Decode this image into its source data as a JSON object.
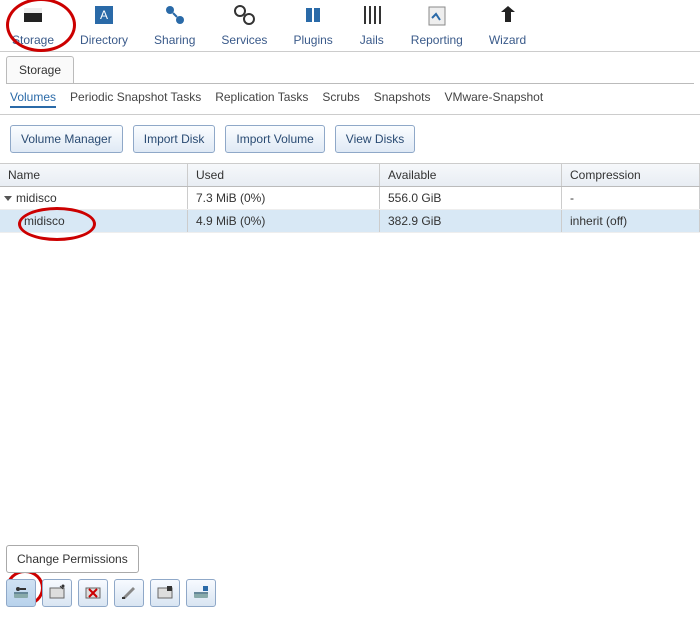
{
  "nav": {
    "items": [
      {
        "label": "Storage",
        "icon": "storage"
      },
      {
        "label": "Directory",
        "icon": "directory"
      },
      {
        "label": "Sharing",
        "icon": "sharing"
      },
      {
        "label": "Services",
        "icon": "services"
      },
      {
        "label": "Plugins",
        "icon": "plugins"
      },
      {
        "label": "Jails",
        "icon": "jails"
      },
      {
        "label": "Reporting",
        "icon": "reporting"
      },
      {
        "label": "Wizard",
        "icon": "wizard"
      }
    ]
  },
  "main_tab": {
    "label": "Storage"
  },
  "sub_tabs": {
    "items": [
      {
        "label": "Volumes",
        "active": true
      },
      {
        "label": "Periodic Snapshot Tasks"
      },
      {
        "label": "Replication Tasks"
      },
      {
        "label": "Scrubs"
      },
      {
        "label": "Snapshots"
      },
      {
        "label": "VMware-Snapshot"
      }
    ]
  },
  "buttons": {
    "volume_manager": "Volume Manager",
    "import_disk": "Import Disk",
    "import_volume": "Import Volume",
    "view_disks": "View Disks"
  },
  "grid": {
    "headers": {
      "name": "Name",
      "used": "Used",
      "available": "Available",
      "compression": "Compression"
    },
    "rows": [
      {
        "name": "midisco",
        "used": "7.3 MiB (0%)",
        "available": "556.0 GiB",
        "compression": "-",
        "indent": 0,
        "selected": false
      },
      {
        "name": "midisco",
        "used": "4.9 MiB (0%)",
        "available": "382.9 GiB",
        "compression": "inherit (off)",
        "indent": 1,
        "selected": true
      }
    ]
  },
  "bottom": {
    "tooltip": "Change Permissions",
    "actions": [
      {
        "name": "change-permissions",
        "active": true
      },
      {
        "name": "create-dataset"
      },
      {
        "name": "create-zvol"
      },
      {
        "name": "edit-options"
      },
      {
        "name": "create-snapshot"
      },
      {
        "name": "destroy-dataset"
      }
    ]
  }
}
